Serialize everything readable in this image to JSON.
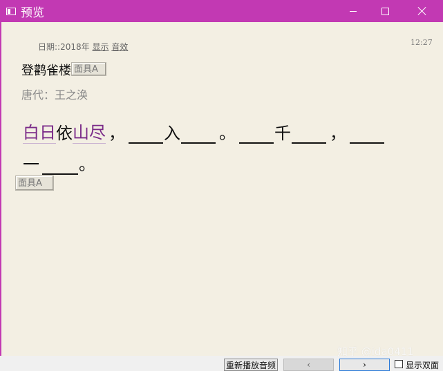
{
  "window": {
    "title": "预览"
  },
  "header": {
    "date_text": "日期::2018年",
    "show_link": "显示",
    "sound_link": "音效",
    "time": "12:27"
  },
  "poem": {
    "title": "登鹳雀楼",
    "mask_label": "面具A",
    "author": "唐代：王之涣",
    "line1": {
      "s1": "白日",
      "s2": "依",
      "s3": "山尽",
      "p1": "，",
      "s4": "入",
      "p2": "。",
      "s5": "千",
      "p3": "，"
    },
    "line2": {
      "s1": "一",
      "p1": "。"
    }
  },
  "mask_button_2": "面具A",
  "bottom": {
    "replay": "重新播放音频",
    "prev": "‹",
    "next": "›",
    "double_side": "显示双面"
  },
  "watermark": "知乎 @ida0411"
}
